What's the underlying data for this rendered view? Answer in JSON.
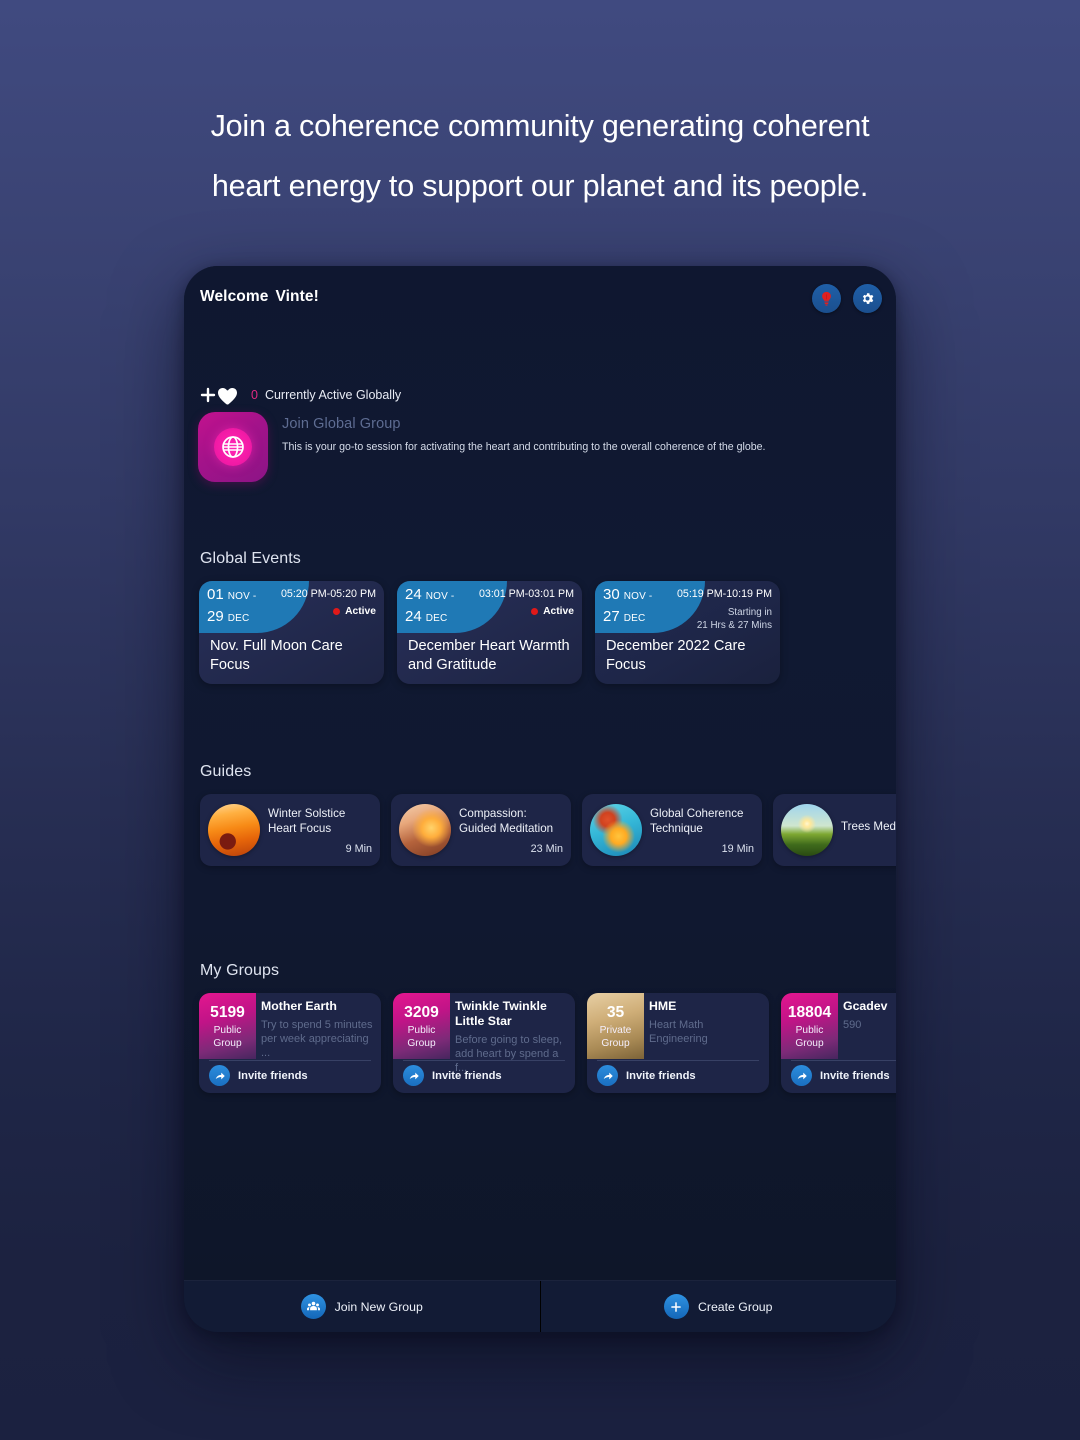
{
  "headline": {
    "line1": "Join a coherence community generating coherent",
    "line2": "heart energy to support our planet and its people."
  },
  "app": {
    "header": {
      "welcome_label": "Welcome",
      "user_name": "Vinte!",
      "idea_icon": "lightbulb-icon",
      "settings_icon": "gear-icon"
    },
    "active_globally": {
      "heart_icon": "plus-heart-icon",
      "count": "0",
      "label": "Currently Active Globally",
      "count_color": "#e12a82"
    },
    "global_group": {
      "icon": "globe-icon",
      "title": "Join Global Group",
      "description": "This is your go-to session for activating the heart and contributing to the overall coherence of the globe."
    },
    "sections": {
      "events_title": "Global Events",
      "guides_title": "Guides",
      "groups_title": "My Groups"
    },
    "events": [
      {
        "start_day": "01",
        "start_month": "NOV -",
        "end_day": "29",
        "end_month": "DEC",
        "time": "05:20 PM-05:20 PM",
        "status": "Active",
        "status_color": "#e01919",
        "starting_in": "",
        "name": "Nov. Full Moon Care Focus"
      },
      {
        "start_day": "24",
        "start_month": "NOV -",
        "end_day": "24",
        "end_month": "DEC",
        "time": "03:01 PM-03:01 PM",
        "status": "Active",
        "status_color": "#e01919",
        "starting_in": "",
        "name": "December Heart Warmth and Gratitude"
      },
      {
        "start_day": "30",
        "start_month": "NOV -",
        "end_day": "27",
        "end_month": "DEC",
        "time": "05:19 PM-10:19 PM",
        "status": "",
        "starting_in": "Starting in\n21 Hrs & 27 Mins",
        "starting_in_l1": "Starting in",
        "starting_in_l2": "21 Hrs & 27 Mins",
        "name": "December 2022 Care Focus"
      }
    ],
    "guides": [
      {
        "name": "Winter Solstice Heart Focus",
        "duration": "9 Min",
        "thumb": "sunset-clouds-thumb"
      },
      {
        "name": "Compassion: Guided Meditation",
        "duration": "23 Min",
        "thumb": "hands-heart-thumb"
      },
      {
        "name": "Global Coherence Technique",
        "duration": "19 Min",
        "thumb": "globe-heart-thumb"
      },
      {
        "name": "Trees Medit",
        "duration": "",
        "thumb": "tree-field-thumb"
      }
    ],
    "groups": [
      {
        "count": "5199",
        "kind_l1": "Public",
        "kind_l2": "Group",
        "name": "Mother Earth",
        "description": "Try to spend 5 minutes per week appreciating ...",
        "invite_label": "Invite friends",
        "badge_style": "pink"
      },
      {
        "count": "3209",
        "kind_l1": "Public",
        "kind_l2": "Group",
        "name": "Twinkle Twinkle Little Star",
        "description": "Before going to sleep, add heart by spend a f...",
        "invite_label": "Invite friends",
        "badge_style": "pink"
      },
      {
        "count": "35",
        "kind_l1": "Private",
        "kind_l2": "Group",
        "name": "HME",
        "description": "Heart Math Engineering",
        "invite_label": "Invite friends",
        "badge_style": "gold"
      },
      {
        "count": "18804",
        "kind_l1": "Public",
        "kind_l2": "Group",
        "name": "Gcadev",
        "description": "590",
        "invite_label": "Invite friends",
        "badge_style": "pink"
      }
    ],
    "bottom_bar": {
      "join_label": "Join New Group",
      "join_icon": "group-people-icon",
      "create_label": "Create Group",
      "create_icon": "plus-icon"
    }
  }
}
